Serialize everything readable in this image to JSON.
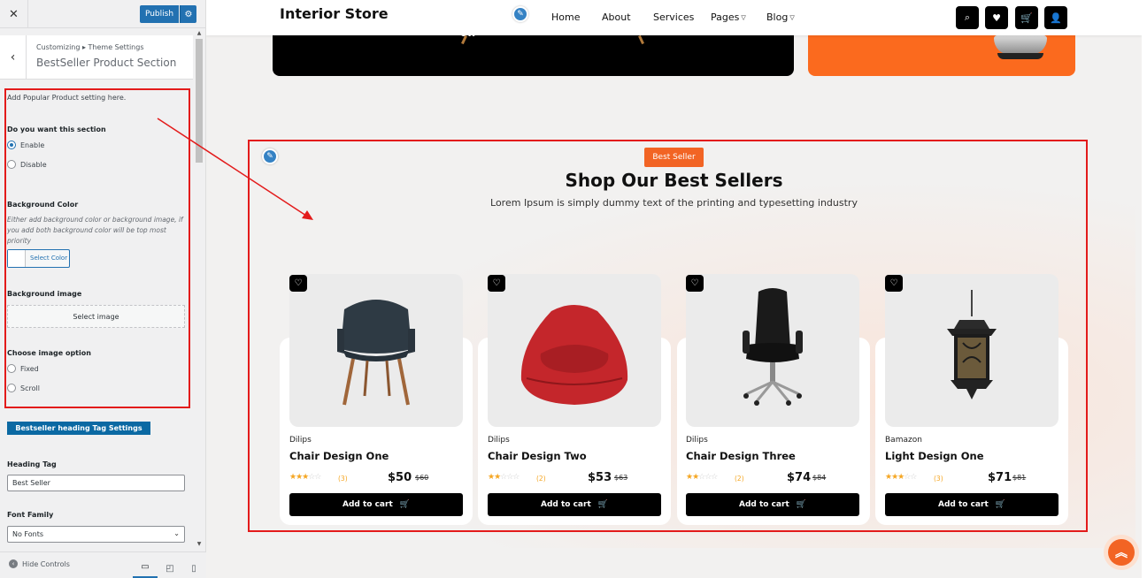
{
  "customizer": {
    "publish_label": "Publish",
    "breadcrumb": "Customizing ▸ Theme Settings",
    "section_title": "BestSeller Product Section",
    "intro": "Add Popular Product setting here.",
    "enable_question": "Do you want this section",
    "enable_options": [
      "Enable",
      "Disable"
    ],
    "enable_selected": "Enable",
    "bg_color_label": "Background Color",
    "bg_color_desc": "Either add background color or background image, if you add both background color will be top most priority",
    "select_color": "Select Color",
    "bg_image_label": "Background image",
    "select_image": "Select image",
    "image_option_label": "Choose image option",
    "image_options": [
      "Fixed",
      "Scroll"
    ],
    "heading_settings_btn": "Bestseller heading Tag Settings",
    "heading_tag_label": "Heading Tag",
    "heading_tag_value": "Best Seller",
    "font_family_label": "Font Family",
    "font_family_value": "No Fonts",
    "hide_controls": "Hide Controls"
  },
  "site": {
    "logo": "Interior Store",
    "nav": [
      "Home",
      "About",
      "Services",
      "Pages",
      "Blog"
    ],
    "banner_text": "off",
    "badge": "Best Seller",
    "heading": "Shop Our Best Sellers",
    "subheading": "Lorem Ipsum is simply dummy text of the printing and typesetting industry",
    "add_to_cart": "Add to cart",
    "products": [
      {
        "brand": "Dilips",
        "name": "Chair Design One",
        "rating": 3,
        "count": "(3)",
        "price": "$50",
        "old_price": "$60"
      },
      {
        "brand": "Dilips",
        "name": "Chair Design Two",
        "rating": 2,
        "count": "(2)",
        "price": "$53",
        "old_price": "$63"
      },
      {
        "brand": "Dilips",
        "name": "Chair Design Three",
        "rating": 2,
        "count": "(2)",
        "price": "$74",
        "old_price": "$84"
      },
      {
        "brand": "Bamazon",
        "name": "Light Design One",
        "rating": 3,
        "count": "(3)",
        "price": "$71",
        "old_price": "$81"
      }
    ]
  },
  "colors": {
    "accent_orange": "#f26424",
    "wp_blue": "#2271b1",
    "highlight_red": "#e31b1b"
  }
}
